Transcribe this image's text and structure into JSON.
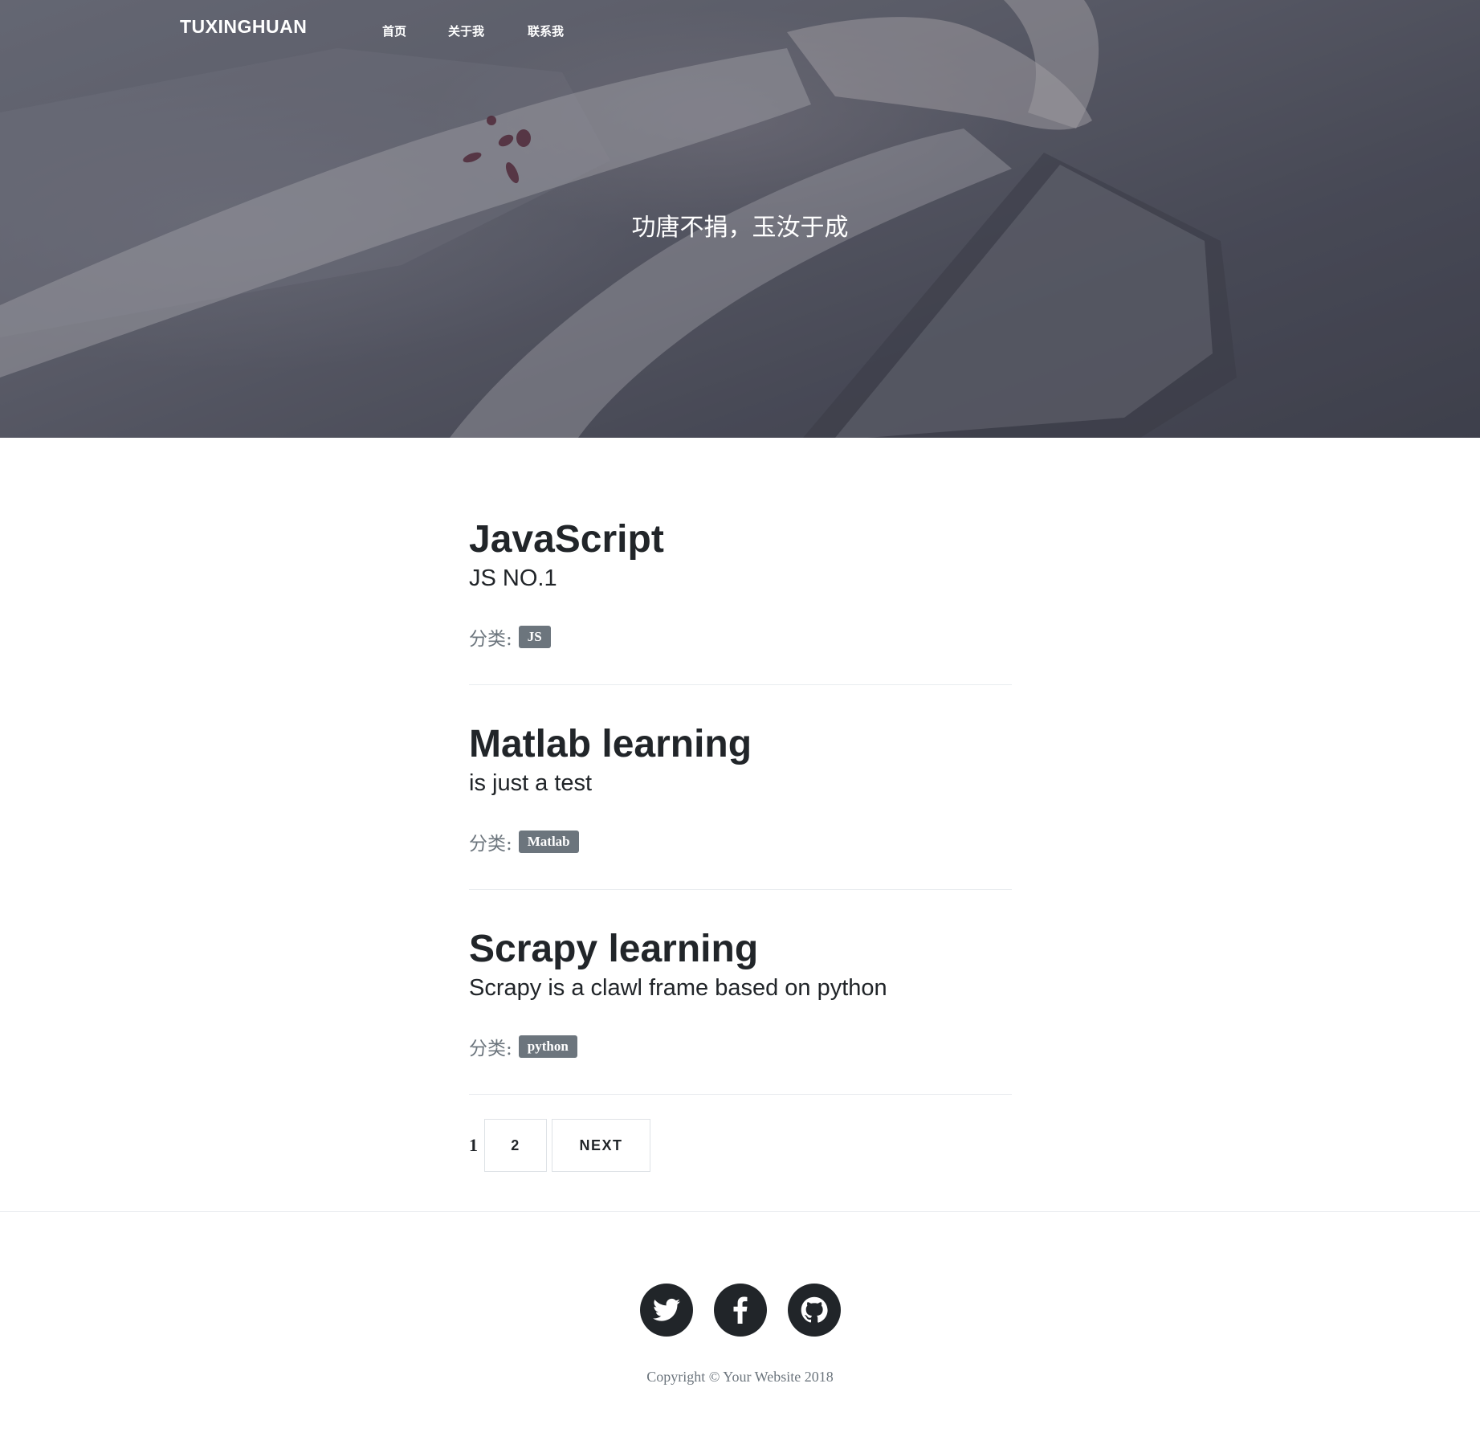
{
  "colors": {
    "text": "#212529",
    "muted": "#6c757d",
    "tag_bg": "#6c757d",
    "divider": "#e9ecef",
    "social_bg": "#212529",
    "white": "#ffffff"
  },
  "navbar": {
    "brand": "TUXINGHUAN",
    "links": [
      {
        "label": "首页"
      },
      {
        "label": "关于我"
      },
      {
        "label": "联系我"
      }
    ]
  },
  "hero": {
    "motto": "功唐不捐，玉汝于成"
  },
  "posts": [
    {
      "title": "JavaScript",
      "subtitle": "JS NO.1",
      "category_label": "分类:",
      "tag": "JS"
    },
    {
      "title": "Matlab learning",
      "subtitle": "is just a test",
      "category_label": "分类:",
      "tag": "Matlab"
    },
    {
      "title": "Scrapy learning",
      "subtitle": "Scrapy is a clawl frame based on python",
      "category_label": "分类:",
      "tag": "python"
    }
  ],
  "pagination": {
    "current": "1",
    "page_2": "2",
    "next": "NEXT"
  },
  "footer": {
    "social": [
      {
        "icon": "twitter-icon"
      },
      {
        "icon": "facebook-icon"
      },
      {
        "icon": "github-icon"
      }
    ],
    "copyright": "Copyright © Your Website 2018"
  }
}
